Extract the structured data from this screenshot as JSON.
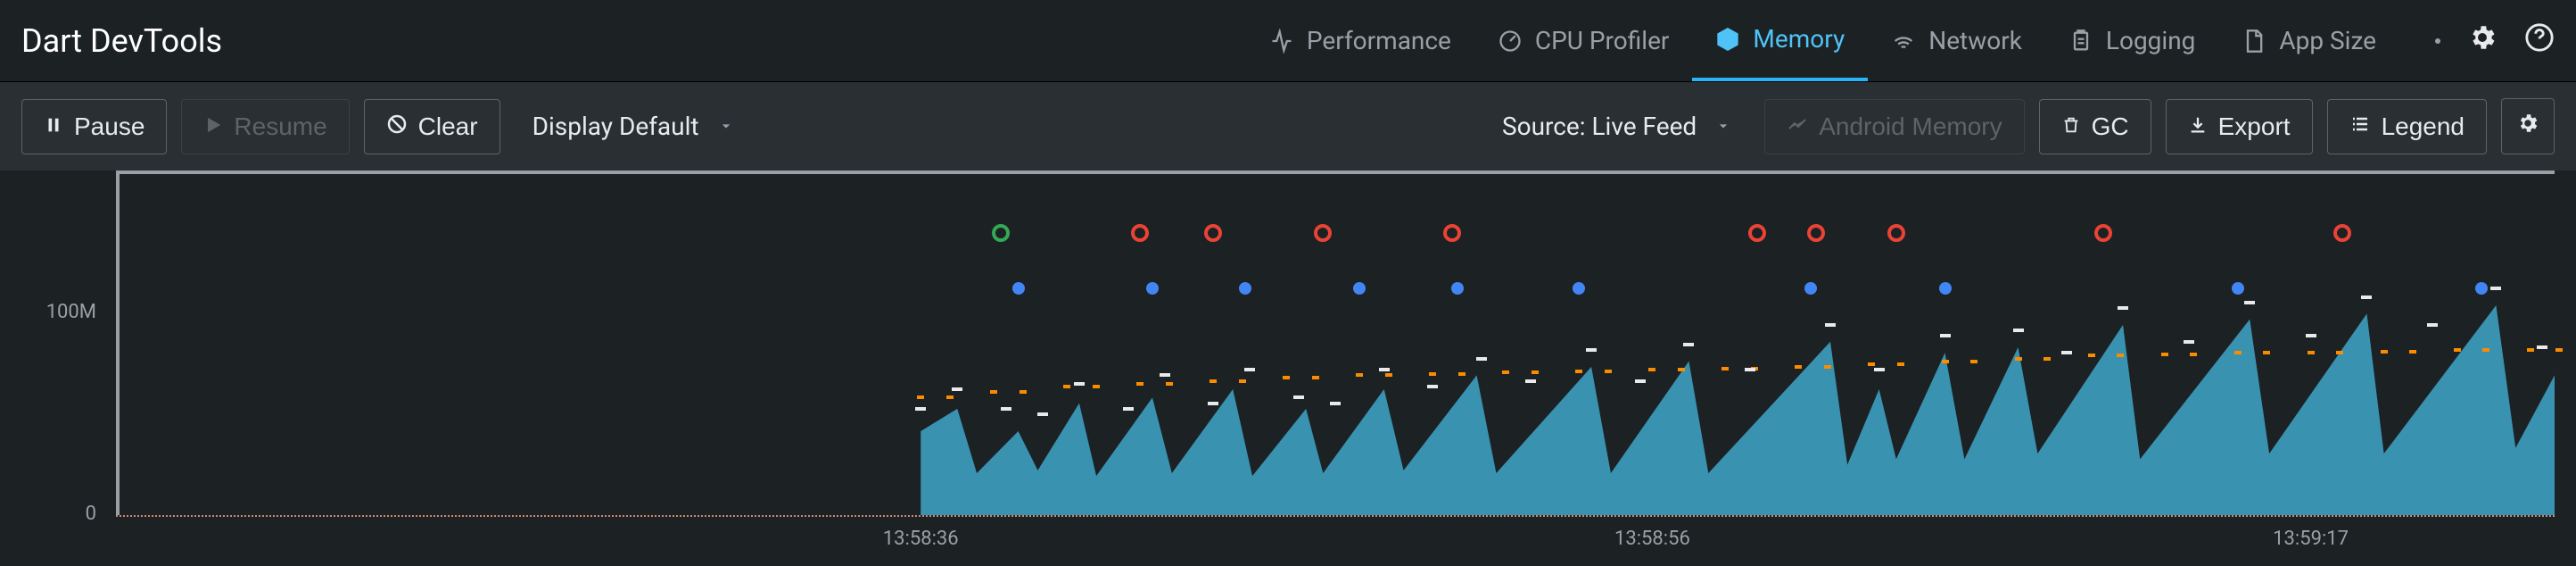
{
  "header": {
    "title": "Dart DevTools",
    "tabs": [
      {
        "id": "performance",
        "label": "Performance"
      },
      {
        "id": "cpu-profiler",
        "label": "CPU Profiler"
      },
      {
        "id": "memory",
        "label": "Memory",
        "active": true
      },
      {
        "id": "network",
        "label": "Network"
      },
      {
        "id": "logging",
        "label": "Logging"
      },
      {
        "id": "app-size",
        "label": "App Size"
      }
    ]
  },
  "toolbar": {
    "pause": "Pause",
    "resume": "Resume",
    "clear": "Clear",
    "display": "Display Default",
    "source": "Source: Live Feed",
    "android_memory": "Android Memory",
    "gc": "GC",
    "export": "Export",
    "legend": "Legend"
  },
  "chart_data": {
    "type": "area",
    "ylabel": "",
    "ylim": [
      0,
      120
    ],
    "y_ticks": [
      {
        "v": 0,
        "label": "0"
      },
      {
        "v": 100,
        "label": "100M"
      }
    ],
    "x_ticks": [
      {
        "pct": 33.0,
        "label": "13:58:36"
      },
      {
        "pct": 63.0,
        "label": "13:58:56"
      },
      {
        "pct": 90.0,
        "label": "13:59:17"
      }
    ],
    "data_start_pct": 33.0,
    "series": [
      {
        "name": "used-heap",
        "style": "area",
        "color": "#3ea6c9",
        "points_pct": [
          [
            33.0,
            30
          ],
          [
            34.5,
            38
          ],
          [
            35.3,
            15
          ],
          [
            37.0,
            30
          ],
          [
            37.8,
            16
          ],
          [
            39.5,
            40
          ],
          [
            40.2,
            14
          ],
          [
            42.5,
            42
          ],
          [
            43.3,
            15
          ],
          [
            45.8,
            45
          ],
          [
            46.6,
            14
          ],
          [
            48.8,
            38
          ],
          [
            49.5,
            15
          ],
          [
            52.0,
            45
          ],
          [
            52.8,
            16
          ],
          [
            55.8,
            50
          ],
          [
            56.6,
            15
          ],
          [
            60.5,
            53
          ],
          [
            61.3,
            15
          ],
          [
            64.5,
            55
          ],
          [
            65.3,
            15
          ],
          [
            70.3,
            62
          ],
          [
            71.0,
            18
          ],
          [
            72.3,
            45
          ],
          [
            73.0,
            20
          ],
          [
            75.0,
            58
          ],
          [
            75.8,
            20
          ],
          [
            78.0,
            60
          ],
          [
            78.8,
            22
          ],
          [
            82.3,
            68
          ],
          [
            83.0,
            20
          ],
          [
            87.5,
            70
          ],
          [
            88.3,
            22
          ],
          [
            92.3,
            72
          ],
          [
            93.0,
            22
          ],
          [
            97.6,
            75
          ],
          [
            98.4,
            24
          ],
          [
            100,
            50
          ]
        ]
      },
      {
        "name": "capacity",
        "style": "dashed",
        "color": "#fb8c00",
        "points_pct": [
          [
            33.0,
            42
          ],
          [
            36,
            44
          ],
          [
            39,
            46
          ],
          [
            42,
            47
          ],
          [
            45,
            48
          ],
          [
            48,
            49
          ],
          [
            51,
            50
          ],
          [
            54,
            50.5
          ],
          [
            57,
            51
          ],
          [
            60,
            51.5
          ],
          [
            63,
            52
          ],
          [
            66,
            52.5
          ],
          [
            69,
            53
          ],
          [
            72,
            54
          ],
          [
            75,
            55
          ],
          [
            78,
            56
          ],
          [
            81,
            57
          ],
          [
            84,
            57.5
          ],
          [
            87,
            58
          ],
          [
            90,
            58
          ],
          [
            93,
            58.5
          ],
          [
            96,
            59
          ],
          [
            99,
            59
          ]
        ]
      },
      {
        "name": "rss",
        "style": "ticks",
        "color": "#e8eaed",
        "points_pct": [
          [
            33.0,
            38
          ],
          [
            34.5,
            45
          ],
          [
            36.5,
            38
          ],
          [
            38.0,
            36
          ],
          [
            39.5,
            47
          ],
          [
            41.5,
            38
          ],
          [
            43.0,
            50
          ],
          [
            45.0,
            40
          ],
          [
            46.5,
            52
          ],
          [
            48.5,
            42
          ],
          [
            50.0,
            40
          ],
          [
            52.0,
            52
          ],
          [
            54.0,
            46
          ],
          [
            56.0,
            56
          ],
          [
            58.0,
            48
          ],
          [
            60.5,
            59
          ],
          [
            62.5,
            48
          ],
          [
            64.5,
            61
          ],
          [
            67.0,
            52
          ],
          [
            70.3,
            68
          ],
          [
            72.3,
            52
          ],
          [
            75.0,
            64
          ],
          [
            78.0,
            66
          ],
          [
            80.0,
            58
          ],
          [
            82.3,
            74
          ],
          [
            85.0,
            62
          ],
          [
            87.5,
            76
          ],
          [
            90.0,
            64
          ],
          [
            92.3,
            78
          ],
          [
            95.0,
            68
          ],
          [
            97.6,
            81
          ],
          [
            99.5,
            60
          ]
        ]
      }
    ],
    "events": {
      "rings": [
        {
          "pct": 36.3,
          "color": "green"
        },
        {
          "pct": 42.0,
          "color": "red"
        },
        {
          "pct": 45.0,
          "color": "red"
        },
        {
          "pct": 49.5,
          "color": "red"
        },
        {
          "pct": 54.8,
          "color": "red"
        },
        {
          "pct": 67.3,
          "color": "red"
        },
        {
          "pct": 69.7,
          "color": "red"
        },
        {
          "pct": 73.0,
          "color": "red"
        },
        {
          "pct": 81.5,
          "color": "red"
        },
        {
          "pct": 91.3,
          "color": "red"
        }
      ],
      "dots": [
        {
          "pct": 37.0
        },
        {
          "pct": 42.5
        },
        {
          "pct": 46.3
        },
        {
          "pct": 51.0
        },
        {
          "pct": 55.0
        },
        {
          "pct": 60.0
        },
        {
          "pct": 69.5
        },
        {
          "pct": 75.0
        },
        {
          "pct": 87.0
        },
        {
          "pct": 97.0
        }
      ]
    }
  }
}
